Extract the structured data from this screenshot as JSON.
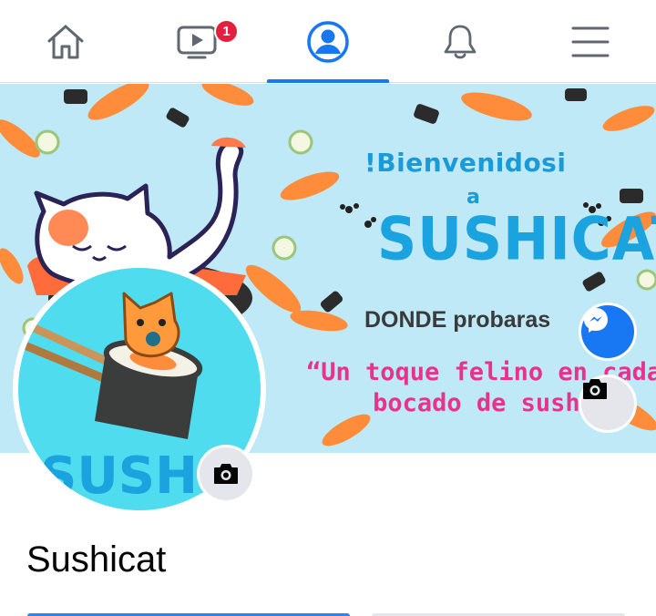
{
  "nav": {
    "tabs": [
      {
        "name": "home",
        "icon": "home-icon"
      },
      {
        "name": "watch",
        "icon": "video-icon",
        "badge": "1"
      },
      {
        "name": "profile",
        "icon": "profile-icon",
        "active": true
      },
      {
        "name": "notifications",
        "icon": "bell-icon"
      },
      {
        "name": "menu",
        "icon": "menu-icon"
      }
    ],
    "accent_color": "#1877f2",
    "badge_color": "#e41e3f"
  },
  "cover": {
    "title": "!Bienvenidosi",
    "connector": "a",
    "brand": "SUSHICAT",
    "line1": "DONDE probaras",
    "quote_line1": "“Un toque felino en cada",
    "quote_line2": "bocado de sushi",
    "background_color": "#bfe9f6",
    "brand_color": "#1aa3de",
    "quote_color": "#e8338e"
  },
  "avatar": {
    "brand": "SUSHICAT",
    "background_color": "#4fdcef"
  },
  "profile": {
    "name": "Sushicat"
  },
  "icons": {
    "cover_action": "messenger-icon",
    "cover_camera": "camera-icon",
    "avatar_camera": "camera-icon"
  }
}
